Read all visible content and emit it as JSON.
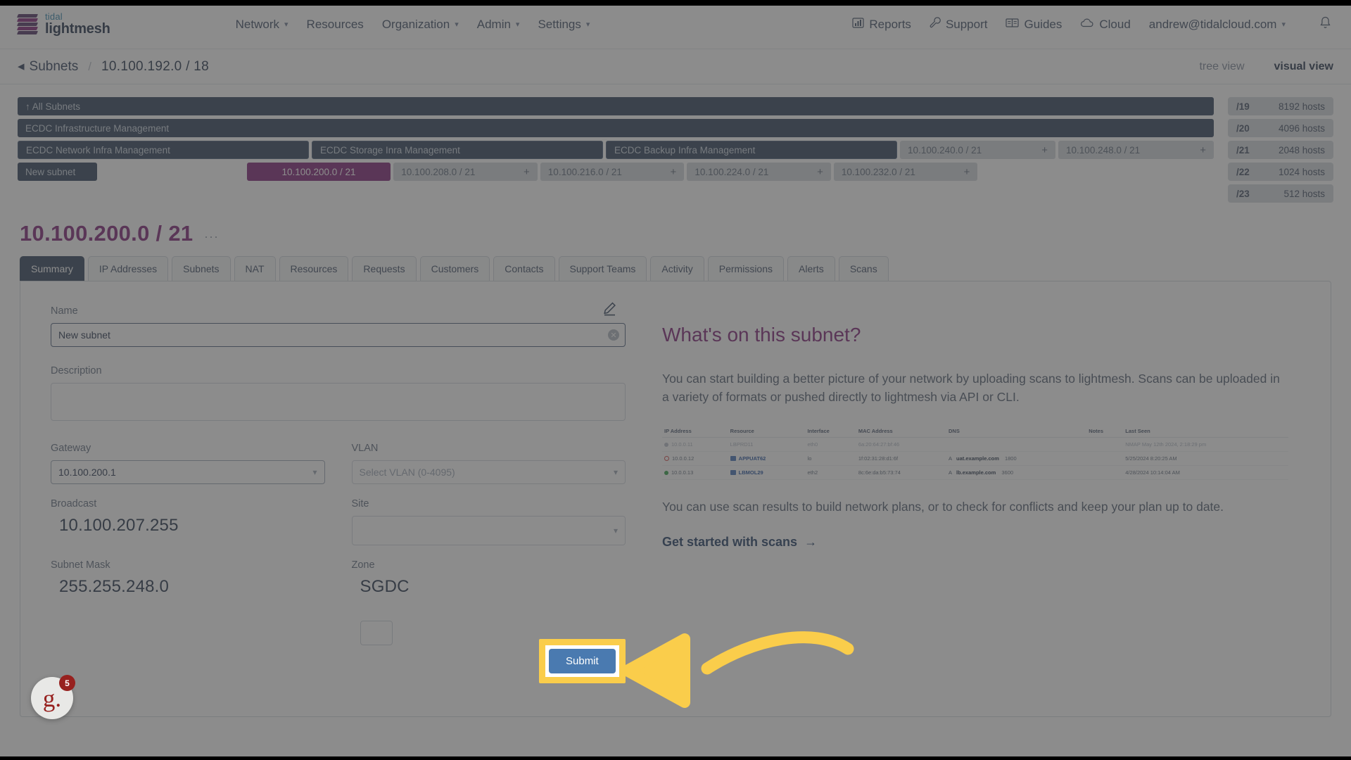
{
  "topnav": {
    "brand_top": "tidal",
    "brand_bottom": "lightmesh",
    "items": [
      {
        "label": "Network",
        "has_caret": true
      },
      {
        "label": "Resources",
        "has_caret": false
      },
      {
        "label": "Organization",
        "has_caret": true
      },
      {
        "label": "Admin",
        "has_caret": true
      },
      {
        "label": "Settings",
        "has_caret": true
      }
    ],
    "right_items": [
      {
        "label": "Reports",
        "icon": "bar-chart-icon"
      },
      {
        "label": "Support",
        "icon": "wrench-icon"
      },
      {
        "label": "Guides",
        "icon": "book-icon"
      },
      {
        "label": "Cloud",
        "icon": "cloud-icon"
      }
    ],
    "account": "andrew@tidalcloud.com",
    "notification_icon": "bell-icon"
  },
  "breadcrumb": {
    "back_label": "Subnets",
    "separator": "/",
    "current": "10.100.192.0 / 18",
    "views": [
      {
        "label": "tree view",
        "active": false
      },
      {
        "label": "visual view",
        "active": true
      }
    ]
  },
  "map": {
    "rows": [
      [
        {
          "label": "↑ All Subnets",
          "style": "dark",
          "flex": 100
        }
      ],
      [
        {
          "label": "ECDC Infrastructure Management",
          "style": "dark",
          "flex": 100
        }
      ],
      [
        {
          "label": "ECDC Network Infra Management",
          "style": "dark2",
          "flex": 24.5
        },
        {
          "label": "ECDC Storage Inra Management",
          "style": "dark2",
          "flex": 24.5
        },
        {
          "label": "ECDC Backup Infra Management",
          "style": "dark2",
          "flex": 24.5
        },
        {
          "label": "10.100.240.0 / 21",
          "style": "ghost",
          "flex": 12.5,
          "plus": "+"
        },
        {
          "label": "10.100.248.0 / 21",
          "style": "ghost",
          "flex": 12.5,
          "plus": "+"
        }
      ],
      [
        {
          "label": "New subnet",
          "style": "dark",
          "flex": 6.1
        },
        {
          "label": "",
          "style": "empty",
          "flex": 12.2
        },
        {
          "label": "10.100.200.0 / 21",
          "style": "purple",
          "flex": 12.2
        },
        {
          "label": "10.100.208.0 / 21",
          "style": "ghost",
          "flex": 12.2,
          "plus": "+"
        },
        {
          "label": "10.100.216.0 / 21",
          "style": "ghost",
          "flex": 12.2,
          "plus": "+"
        },
        {
          "label": "10.100.224.0 / 21",
          "style": "ghost",
          "flex": 12.2,
          "plus": "+"
        },
        {
          "label": "10.100.232.0 / 21",
          "style": "ghost",
          "flex": 12.2,
          "plus": "+"
        },
        {
          "label": "",
          "style": "empty",
          "flex": 20.7
        }
      ]
    ],
    "masks": [
      {
        "mask": "/19",
        "hosts": "8192 hosts"
      },
      {
        "mask": "/20",
        "hosts": "4096 hosts"
      },
      {
        "mask": "/21",
        "hosts": "2048 hosts"
      },
      {
        "mask": "/22",
        "hosts": "1024 hosts"
      },
      {
        "mask": "/23",
        "hosts": "512 hosts"
      }
    ]
  },
  "subnet": {
    "title": "10.100.200.0 / 21",
    "more": "...",
    "tabs": [
      {
        "label": "Summary",
        "active": true
      },
      {
        "label": "IP Addresses",
        "active": false
      },
      {
        "label": "Subnets",
        "active": false
      },
      {
        "label": "NAT",
        "active": false
      },
      {
        "label": "Resources",
        "active": false
      },
      {
        "label": "Requests",
        "active": false
      },
      {
        "label": "Customers",
        "active": false
      },
      {
        "label": "Contacts",
        "active": false
      },
      {
        "label": "Support Teams",
        "active": false
      },
      {
        "label": "Activity",
        "active": false
      },
      {
        "label": "Permissions",
        "active": false
      },
      {
        "label": "Alerts",
        "active": false
      },
      {
        "label": "Scans",
        "active": false
      }
    ]
  },
  "form": {
    "edit_icon": "pencil-icon",
    "name_label": "Name",
    "name_value": "New subnet",
    "name_clear_icon": "clear-icon",
    "description_label": "Description",
    "description_value": "",
    "description_placeholder": "",
    "gateway_label": "Gateway",
    "gateway_value": "10.100.200.1",
    "vlan_label": "VLAN",
    "vlan_placeholder": "Select VLAN (0-4095)",
    "broadcast_label": "Broadcast",
    "broadcast_value": "10.100.207.255",
    "site_label": "Site",
    "site_value": "",
    "subnet_mask_label": "Subnet Mask",
    "subnet_mask_value": "255.255.248.0",
    "zone_label": "Zone",
    "zone_value": "SGDC",
    "submit_label": "Submit",
    "cancel_label": ""
  },
  "promo": {
    "heading": "What's on this subnet?",
    "paragraph1": "You can start building a better picture of your network by uploading scans to lightmesh. Scans can be uploaded in a variety of formats or pushed directly to lightmesh via API or CLI.",
    "paragraph2": "You can use scan results to build network plans, or to check for conflicts and keep your plan up to date.",
    "link": "Get started with scans",
    "link_icon": "arrow-right-icon",
    "table": {
      "headers": [
        "IP Address",
        "Resource",
        "Interface",
        "MAC Address",
        "DNS",
        "Notes",
        "Last Seen"
      ],
      "rows": [
        {
          "status": "gray",
          "ip": "10.0.0.11",
          "resource": "LBPRD11",
          "resource_dim": true,
          "interface": "eth0",
          "mac": "6a:20:64:27:bf:46",
          "dns_type": "",
          "dns_name": "",
          "dns_ttl": "",
          "notes": "",
          "last_seen": "NMAP May 12th 2024, 2:18:29 pm"
        },
        {
          "status": "red-ring",
          "ip": "10.0.0.12",
          "resource": "APPUAT62",
          "resource_dim": false,
          "interface": "lo",
          "mac": "1f:02:31:28:d1:6f",
          "dns_type": "A",
          "dns_name": "uat.example.com",
          "dns_ttl": "1800",
          "notes": "",
          "last_seen": "5/25/2024 8:20:25 AM"
        },
        {
          "status": "green",
          "ip": "10.0.0.13",
          "resource": "LBMOL29",
          "resource_dim": false,
          "interface": "eth2",
          "mac": "8c:6e:da:b5:73:74",
          "dns_type": "A",
          "dns_name": "lb.example.com",
          "dns_ttl": "3600",
          "notes": "",
          "last_seen": "4/28/2024 10:14:04 AM"
        }
      ]
    }
  },
  "help_widget": {
    "letter": "g.",
    "badge": "5"
  },
  "colors": {
    "brand_purple": "#7d1f74",
    "navy": "#2b3e57",
    "highlight_yellow": "#facd4b",
    "primary_button": "#4a7ab0"
  }
}
